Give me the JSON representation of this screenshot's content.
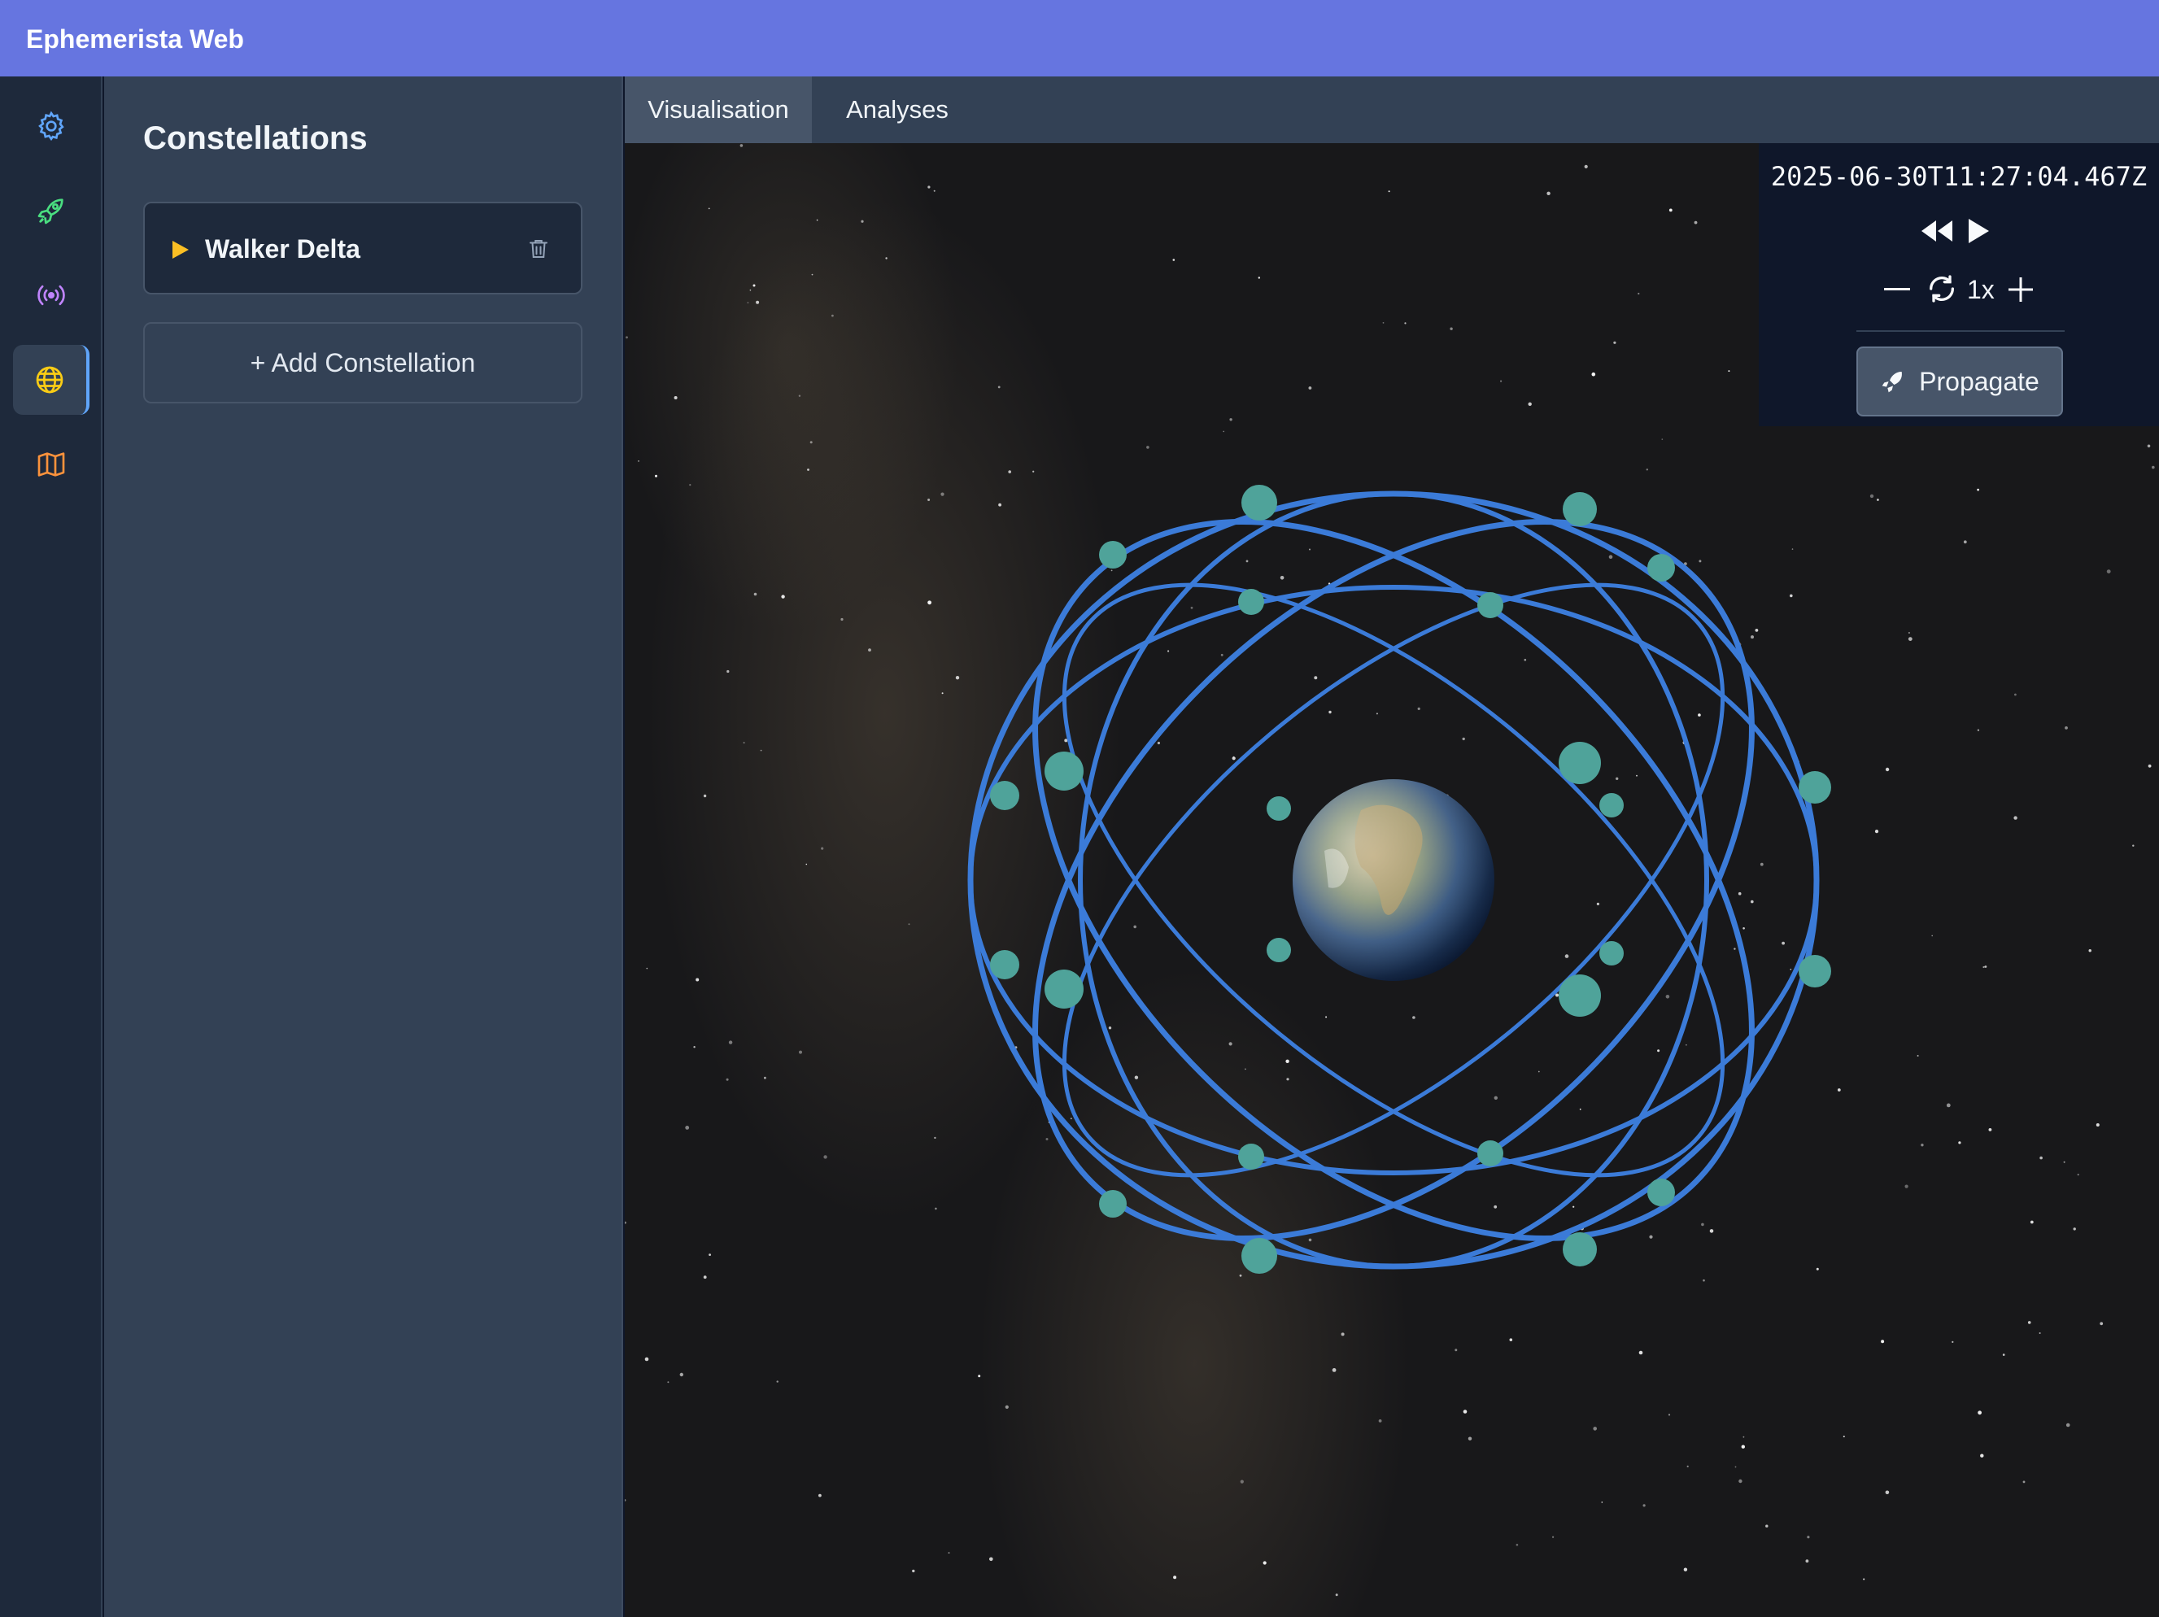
{
  "app": {
    "title": "Ephemerista Web"
  },
  "iconbar": {
    "items": [
      {
        "name": "settings",
        "icon": "gear-icon",
        "color": "#60a5fa",
        "active": false
      },
      {
        "name": "spacecraft",
        "icon": "rocket-icon",
        "color": "#4ade80",
        "active": false
      },
      {
        "name": "ground-stations",
        "icon": "antenna-icon",
        "color": "#c084fc",
        "active": false
      },
      {
        "name": "constellations",
        "icon": "globe-icon",
        "color": "#facc15",
        "active": true
      },
      {
        "name": "maps",
        "icon": "map-icon",
        "color": "#fb923c",
        "active": false
      }
    ]
  },
  "sidebar": {
    "heading": "Constellations",
    "constellations": [
      {
        "name": "Walker Delta",
        "expand_icon": "triangle-right-icon",
        "delete_icon": "trash-icon"
      }
    ],
    "add_label": "+ Add Constellation"
  },
  "tabs": [
    {
      "label": "Visualisation",
      "active": true
    },
    {
      "label": "Analyses",
      "active": false
    }
  ],
  "time_controls": {
    "timestamp": "2025-06-30T11:27:04.467Z",
    "speed": "1x",
    "propagate_label": "Propagate",
    "icons": [
      "rewind-icon",
      "play-icon",
      "minus-icon",
      "reset-icon",
      "plus-icon",
      "rocket-icon"
    ]
  },
  "scene": {
    "orbit_color": "#3b7bd8",
    "satellite_color": "#4fa39a",
    "description_icon": "earth-globe"
  }
}
